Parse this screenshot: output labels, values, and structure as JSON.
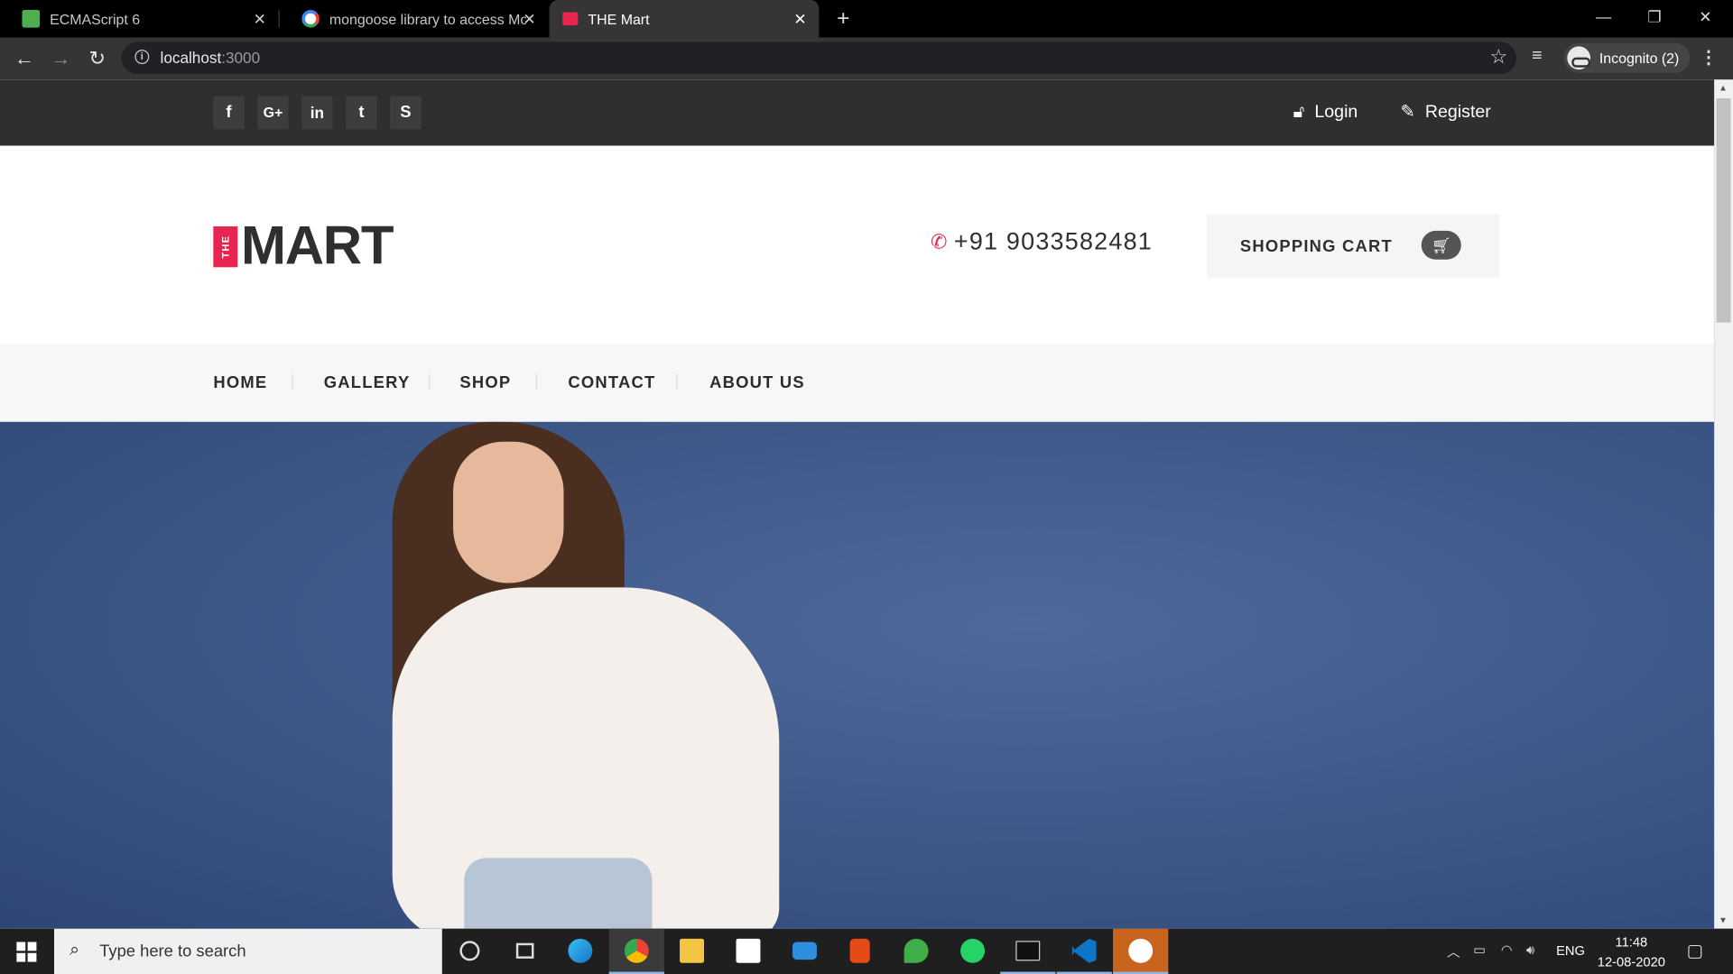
{
  "browser": {
    "tabs": [
      {
        "title": "ECMAScript 6",
        "active": false
      },
      {
        "title": "mongoose library to access Mon",
        "active": false
      },
      {
        "title": "THE Mart",
        "active": true
      }
    ],
    "url_host": "localhost",
    "url_port": ":3000",
    "profile_label": "Incognito (2)"
  },
  "site": {
    "topbar": {
      "social": [
        {
          "name": "facebook",
          "glyph": "f"
        },
        {
          "name": "google-plus",
          "glyph": "G+"
        },
        {
          "name": "linkedin",
          "glyph": "in"
        },
        {
          "name": "twitter",
          "glyph": "t"
        },
        {
          "name": "skype",
          "glyph": "S"
        }
      ],
      "login_label": "Login",
      "register_label": "Register"
    },
    "logo": {
      "badge": "THE",
      "text": "MART"
    },
    "phone": "+91 9033582481",
    "cart_label": "SHOPPING CART",
    "nav": [
      "HOME",
      "GALLERY",
      "SHOP",
      "CONTACT",
      "ABOUT US"
    ]
  },
  "taskbar": {
    "search_placeholder": "Type here to search",
    "language": "ENG",
    "time": "11:48",
    "date": "12-08-2020"
  },
  "colors": {
    "accent": "#e8254f",
    "topbar_bg": "#2f2f2f",
    "hero_bg": "#3f5a8a"
  }
}
